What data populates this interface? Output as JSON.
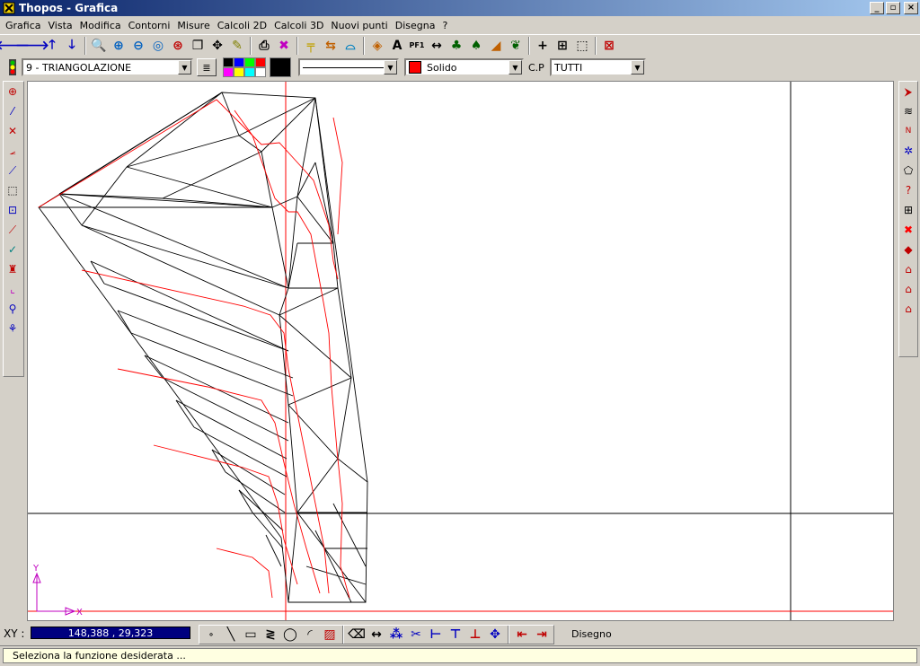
{
  "window": {
    "title": "Thopos - Grafica"
  },
  "menu": [
    "Grafica",
    "Vista",
    "Modifica",
    "Contorni",
    "Misure",
    "Calcoli 2D",
    "Calcoli 3D",
    "Nuovi punti",
    "Disegna",
    "?"
  ],
  "layer": {
    "selected": "9 - TRIANGOLAZIONE"
  },
  "line_style": {
    "selected": ""
  },
  "fill_style": {
    "selected": "Solido",
    "color": "#ff0000"
  },
  "cp": {
    "label": "C.P",
    "selected": "TUTTI"
  },
  "palette": [
    "#000000",
    "#0000ff",
    "#00ff00",
    "#ff0000",
    "#ff00ff",
    "#ffff00",
    "#00ffff",
    "#ffffff"
  ],
  "current_color": "#000000",
  "toolbar_icons": [
    "arrow-left-icon",
    "arrow-right-icon",
    "arrow-up-icon",
    "arrow-down-icon",
    "zoom-window-icon",
    "zoom-in-icon",
    "zoom-out-icon",
    "zoom-prev-icon",
    "zoom-all-icon",
    "copy-icon",
    "pan-icon",
    "pencil-icon",
    "print-icon",
    "settings-icon",
    "dimension-icon",
    "move-icon",
    "measure-icon",
    "query-icon",
    "text-icon",
    "pf1-icon",
    "spacing-icon",
    "tree-icon",
    "tree-alt-icon",
    "profile-icon",
    "plant-icon",
    "crosshair-icon",
    "grid-icon",
    "select-icon",
    "close-drawing-icon"
  ],
  "coords": {
    "label": "XY :",
    "value": "148,388 , 29,323"
  },
  "draw_mode": {
    "label": "Disegno"
  },
  "status": {
    "text": "Seleziona la funzione desiderata ..."
  },
  "axis": {
    "y_label": "Y",
    "x_label": "X"
  },
  "colors": {
    "title_start": "#0a246a",
    "title_end": "#a6caf0",
    "coord_bg": "#00007f",
    "status_bg": "#ffffe1",
    "red_line": "#ff0000"
  }
}
